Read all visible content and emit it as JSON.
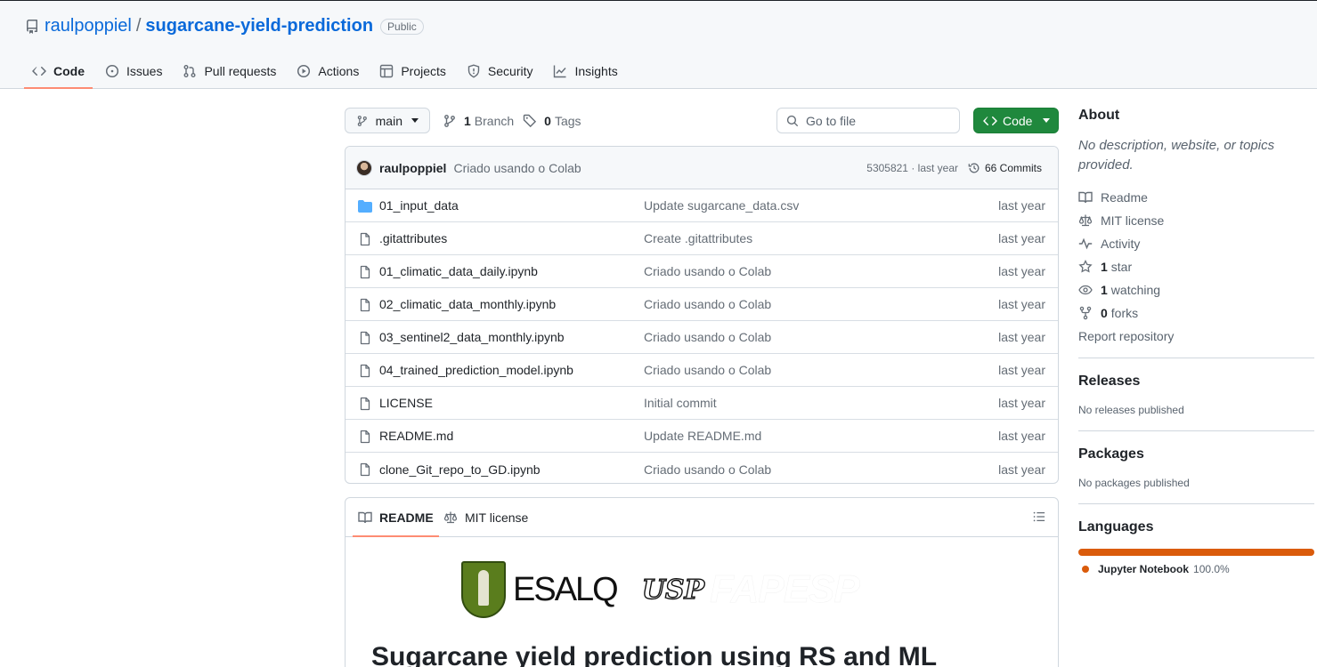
{
  "repo": {
    "owner": "raulpoppiel",
    "separator": "/",
    "name": "sugarcane-yield-prediction",
    "visibility": "Public"
  },
  "tabs": [
    {
      "label": "Code",
      "icon": "code-icon",
      "active": true
    },
    {
      "label": "Issues",
      "icon": "issue-icon"
    },
    {
      "label": "Pull requests",
      "icon": "pull-request-icon"
    },
    {
      "label": "Actions",
      "icon": "play-icon"
    },
    {
      "label": "Projects",
      "icon": "table-icon"
    },
    {
      "label": "Security",
      "icon": "shield-icon"
    },
    {
      "label": "Insights",
      "icon": "graph-icon"
    }
  ],
  "toolbar": {
    "branch": "main",
    "branch_count": "1",
    "branch_label": "Branch",
    "tag_count": "0",
    "tag_label": "Tags",
    "goto_placeholder": "Go to file",
    "code_button": "Code"
  },
  "latest_commit": {
    "author": "raulpoppiel",
    "message": "Criado usando o Colab",
    "meta": "5305821 · last year",
    "commits_label": "66 Commits"
  },
  "files": [
    {
      "name": "01_input_data",
      "type": "folder",
      "message": "Update sugarcane_data.csv",
      "date": "last year"
    },
    {
      "name": ".gitattributes",
      "type": "file",
      "message": "Create .gitattributes",
      "date": "last year"
    },
    {
      "name": "01_climatic_data_daily.ipynb",
      "type": "file",
      "message": "Criado usando o Colab",
      "date": "last year"
    },
    {
      "name": "02_climatic_data_monthly.ipynb",
      "type": "file",
      "message": "Criado usando o Colab",
      "date": "last year"
    },
    {
      "name": "03_sentinel2_data_monthly.ipynb",
      "type": "file",
      "message": "Criado usando o Colab",
      "date": "last year"
    },
    {
      "name": "04_trained_prediction_model.ipynb",
      "type": "file",
      "message": "Criado usando o Colab",
      "date": "last year"
    },
    {
      "name": "LICENSE",
      "type": "file",
      "message": "Initial commit",
      "date": "last year"
    },
    {
      "name": "README.md",
      "type": "file",
      "message": "Update README.md",
      "date": "last year"
    },
    {
      "name": "clone_Git_repo_to_GD.ipynb",
      "type": "file",
      "message": "Criado usando o Colab",
      "date": "last year"
    }
  ],
  "readme": {
    "tab_readme": "README",
    "tab_license": "MIT license",
    "logo_esalq": "ESALQ",
    "logo_usp": "USP",
    "logo_fapesp": "FAPESP",
    "title": "Sugarcane yield prediction using RS and ML"
  },
  "sidebar": {
    "about_heading": "About",
    "about_desc": "No description, website, or topics provided.",
    "readme": "Readme",
    "license": "MIT license",
    "activity": "Activity",
    "stars_count": "1",
    "stars_label": "star",
    "watching_count": "1",
    "watching_label": "watching",
    "forks_count": "0",
    "forks_label": "forks",
    "report": "Report repository",
    "releases_heading": "Releases",
    "releases_empty": "No releases published",
    "packages_heading": "Packages",
    "packages_empty": "No packages published",
    "languages_heading": "Languages",
    "language_name": "Jupyter Notebook",
    "language_pct": "100.0%",
    "language_share": 1.0
  },
  "colors": {
    "link": "#0969da",
    "primary_button": "#1f883d",
    "active_tab_underline": "#fd8c73",
    "jupyter": "#da5b0b",
    "folder": "#54aeff"
  }
}
